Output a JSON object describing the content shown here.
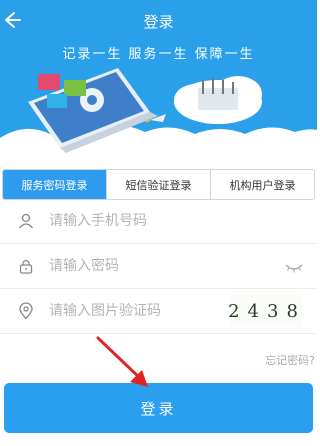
{
  "header": {
    "title": "登录",
    "slogan": "记录一生  服务一生  保障一生"
  },
  "tabs": [
    {
      "label": "服务密码登录",
      "active": true
    },
    {
      "label": "短信验证登录",
      "active": false
    },
    {
      "label": "机构用户登录",
      "active": false
    }
  ],
  "form": {
    "phone_placeholder": "请输入手机号码",
    "password_placeholder": "请输入密码",
    "captcha_placeholder": "请输入图片验证码",
    "captcha_code": "2438"
  },
  "forgot_label": "忘记密码?",
  "login_label": "登录",
  "colors": {
    "header_bg": "#2aa0ea",
    "tab_active": "#2f9bef",
    "button": "#2a9ff0",
    "arrow": "#e02424"
  },
  "icons": [
    "back-arrow-icon",
    "user-icon",
    "lock-icon",
    "eye-closed-icon",
    "location-pin-icon",
    "red-arrow-icon"
  ]
}
